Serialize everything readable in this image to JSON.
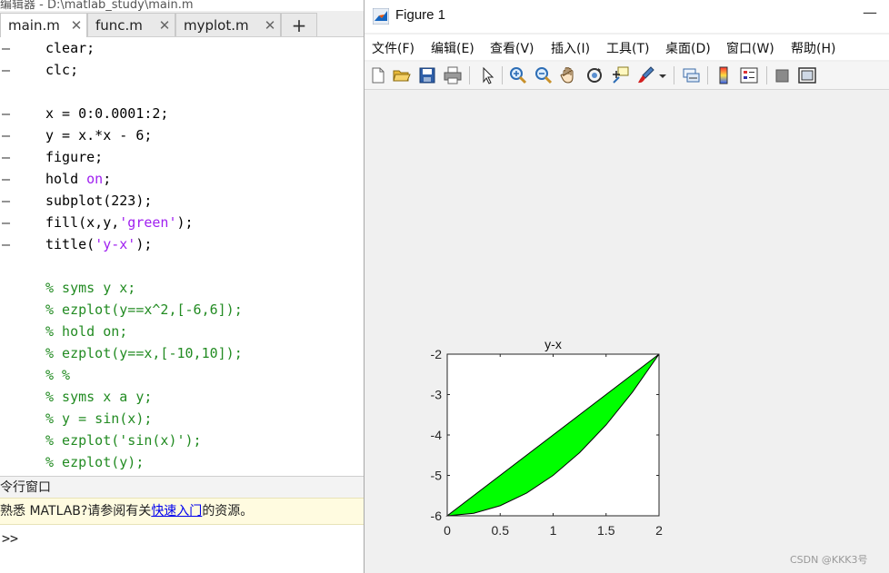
{
  "editor": {
    "title": "编辑器 - D:\\matlab_study\\main.m",
    "tabs": [
      {
        "label": "main.m",
        "active": true
      },
      {
        "label": "func.m",
        "active": false
      },
      {
        "label": "myplot.m",
        "active": false
      }
    ],
    "add_tab_label": "+",
    "close_glyph": "✕",
    "code_lines": [
      {
        "marker": "–",
        "segments": [
          {
            "t": "clear;",
            "c": "kw"
          }
        ]
      },
      {
        "marker": "–",
        "segments": [
          {
            "t": "clc;",
            "c": "kw"
          }
        ]
      },
      {
        "marker": "",
        "segments": []
      },
      {
        "marker": "–",
        "segments": [
          {
            "t": "x = 0:0.0001:2;",
            "c": "kw"
          }
        ]
      },
      {
        "marker": "–",
        "segments": [
          {
            "t": "y = x.*x - 6;",
            "c": "kw"
          }
        ]
      },
      {
        "marker": "–",
        "segments": [
          {
            "t": "figure;",
            "c": "kw"
          }
        ]
      },
      {
        "marker": "–",
        "segments": [
          {
            "t": "hold ",
            "c": "kw"
          },
          {
            "t": "on",
            "c": "str"
          },
          {
            "t": ";",
            "c": "kw"
          }
        ]
      },
      {
        "marker": "–",
        "segments": [
          {
            "t": "subplot(223);",
            "c": "kw"
          }
        ]
      },
      {
        "marker": "–",
        "segments": [
          {
            "t": "fill(x,y,",
            "c": "kw"
          },
          {
            "t": "'green'",
            "c": "str"
          },
          {
            "t": ");",
            "c": "kw"
          }
        ]
      },
      {
        "marker": "–",
        "segments": [
          {
            "t": "title(",
            "c": "kw"
          },
          {
            "t": "'y-x'",
            "c": "str"
          },
          {
            "t": ");",
            "c": "kw"
          }
        ]
      },
      {
        "marker": "",
        "segments": []
      },
      {
        "marker": "",
        "segments": [
          {
            "t": "% syms y x;",
            "c": "cmt"
          }
        ]
      },
      {
        "marker": "",
        "segments": [
          {
            "t": "% ezplot(y==x^2,[-6,6]);",
            "c": "cmt"
          }
        ]
      },
      {
        "marker": "",
        "segments": [
          {
            "t": "% hold on;",
            "c": "cmt"
          }
        ]
      },
      {
        "marker": "",
        "segments": [
          {
            "t": "% ezplot(y==x,[-10,10]);",
            "c": "cmt"
          }
        ]
      },
      {
        "marker": "",
        "segments": [
          {
            "t": "% %",
            "c": "cmt"
          }
        ]
      },
      {
        "marker": "",
        "segments": [
          {
            "t": "% syms x a y;",
            "c": "cmt"
          }
        ]
      },
      {
        "marker": "",
        "segments": [
          {
            "t": "% y = sin(x);",
            "c": "cmt"
          }
        ]
      },
      {
        "marker": "",
        "segments": [
          {
            "t": "% ezplot('sin(x)');",
            "c": "cmt"
          }
        ]
      },
      {
        "marker": "",
        "segments": [
          {
            "t": "% ezplot(y);",
            "c": "cmt"
          }
        ]
      }
    ]
  },
  "command_window": {
    "header": "令行窗口",
    "banner_prefix": "熟悉 MATLAB?请参阅有关",
    "banner_link": "快速入门",
    "banner_suffix": "的资源。",
    "prompt": ">>"
  },
  "figure": {
    "title": "Figure 1",
    "minimize_glyph": "—",
    "menu": [
      "文件(F)",
      "编辑(E)",
      "查看(V)",
      "插入(I)",
      "工具(T)",
      "桌面(D)",
      "窗口(W)",
      "帮助(H)"
    ],
    "toolbar_icons": [
      "new-figure-icon",
      "open-file-icon",
      "save-icon",
      "print-icon",
      "pointer-icon",
      "zoom-in-icon",
      "zoom-out-icon",
      "pan-icon",
      "rotate-3d-icon",
      "data-cursor-icon",
      "brush-icon",
      "link-plot-icon",
      "colorbar-icon",
      "legend-icon",
      "hide-plot-tools-icon",
      "show-plot-tools-icon"
    ]
  },
  "chart_data": {
    "type": "area",
    "title": "y-x",
    "xlabel": "",
    "ylabel": "",
    "xlim": [
      0,
      2
    ],
    "ylim": [
      -6,
      -2
    ],
    "xticks": [
      0,
      0.5,
      1,
      1.5,
      2
    ],
    "xtick_labels": [
      "0",
      "0.5",
      "1",
      "1.5",
      "2"
    ],
    "yticks": [
      -2,
      -3,
      -4,
      -5,
      -6
    ],
    "ytick_labels": [
      "-2",
      "-3",
      "-4",
      "-5",
      "-6"
    ],
    "grid": false,
    "series": [
      {
        "fill_color": "#00ff00",
        "edge_color": "#000000",
        "x": [
          0,
          0.25,
          0.5,
          0.75,
          1,
          1.25,
          1.5,
          1.75,
          2
        ],
        "y": [
          -6,
          -5.9375,
          -5.75,
          -5.4375,
          -5,
          -4.4375,
          -3.75,
          -2.9375,
          -2
        ]
      }
    ]
  },
  "watermark": "CSDN @KKK3号"
}
